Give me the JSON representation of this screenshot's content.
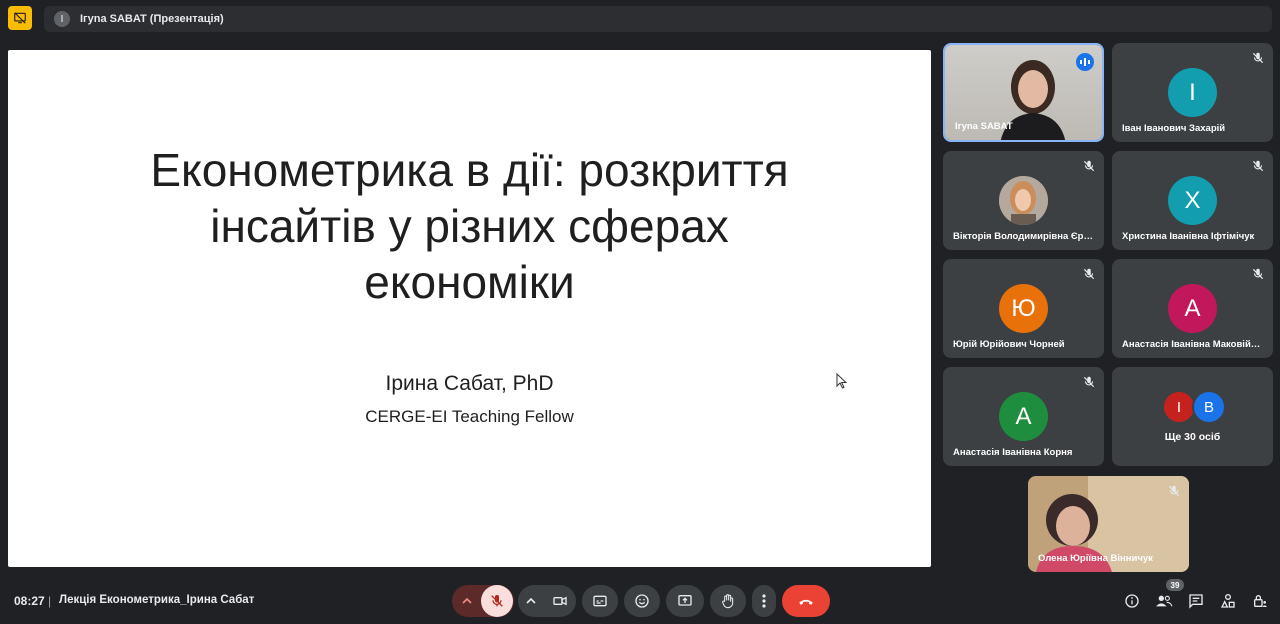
{
  "top_bar": {
    "presenter_initial": "І",
    "presenter_label": "Ігуna SABAT (Презентація)"
  },
  "slide": {
    "title_lines": [
      "Економетрика в дії: розкриття",
      "інсайтів у різних сферах",
      "економіки"
    ],
    "author": "Ірина Сабат, PhD",
    "affiliation": "CERGE-EI Teaching Fellow"
  },
  "participants": [
    {
      "name": "Ігуna SABAT",
      "speaking": true
    },
    {
      "name": "Іван Іванович Захарій",
      "initial": "І",
      "color": "#129eaf"
    },
    {
      "name": "Вікторія Володимирівна Єремеєва"
    },
    {
      "name": "Христина Іванівна Іфтімічук",
      "initial": "Х",
      "color": "#129eaf"
    },
    {
      "name": "Юрій Юрійович Чорней",
      "initial": "Ю",
      "color": "#e8710a"
    },
    {
      "name": "Анастасія Іванівна Маковійчук",
      "initial": "А",
      "color": "#c2185b"
    },
    {
      "name": "Анастасія Іванівна Корня",
      "initial": "А",
      "color": "#1e8e3e"
    }
  ],
  "more": {
    "initials": [
      "І",
      "В"
    ],
    "colors": [
      "#c5221f",
      "#1a73e8"
    ],
    "label": "Ще 30 осіб"
  },
  "self_view": {
    "name": "Олена Юріївна Вінничук"
  },
  "bottom_bar": {
    "time": "08:27",
    "separator": "|",
    "meeting_name": "Лекція Економетрика_Ірина Сабат",
    "people_count": "39"
  },
  "colors": {
    "accent": "#8ab4f8",
    "danger": "#ea4335",
    "mic_off_bg": "#f9dedc"
  }
}
